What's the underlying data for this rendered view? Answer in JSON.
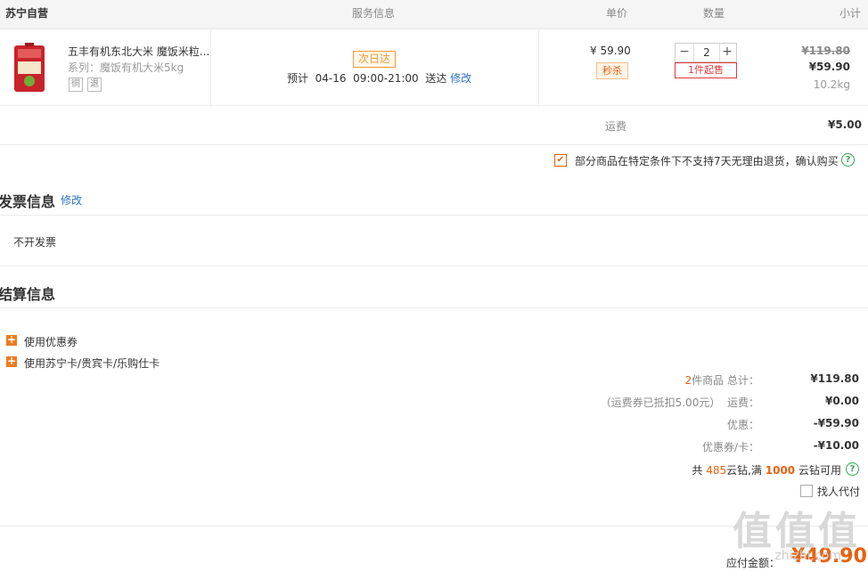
{
  "header": {
    "store": "苏宁自营",
    "service": "服务信息",
    "unit_price": "单价",
    "quantity": "数量",
    "subtotal": "小计"
  },
  "item": {
    "name": "五丰有机东北大米 魔饭米粒...",
    "series": "系列：魔饭有机大米5kg",
    "service_icon_1": "㣚",
    "service_icon_2": "退",
    "next_day": "次日达",
    "eta_prefix": "预计",
    "eta_date": "04-16",
    "eta_time": "09:00-21:00",
    "eta_suffix": "送达",
    "eta_modify": "修改",
    "unit_price": "¥ 59.90",
    "seckill": "秒杀",
    "qty_minus": "−",
    "qty": "2",
    "qty_plus": "+",
    "min_buy": "1件起售",
    "old_price": "¥119.80",
    "new_price": "¥59.90",
    "weight": "10.2kg"
  },
  "shipping": {
    "label": "运费",
    "value": "¥5.00"
  },
  "notice": {
    "text": "部分商品在特定条件下不支持7天无理由退货，确认购买",
    "checked": true
  },
  "invoice": {
    "title": "发票信息",
    "modify": "修改",
    "value": "不开发票"
  },
  "settlement": {
    "title": "结算信息",
    "coupon": "使用优惠券",
    "card": "使用苏宁卡/贵宾卡/乐购仕卡",
    "items_count": "2",
    "items_label": "件商品 总计：",
    "total": "¥119.80",
    "freight_note": "（运费券已抵扣5.00元）",
    "freight_label": "运费：",
    "freight_value": "¥0.00",
    "discount_label": "优惠：",
    "discount_value": "-¥59.90",
    "voucher_label": "优惠券/卡：",
    "voucher_value": "-¥10.00",
    "diamond_prefix": "共",
    "diamond_count": "485",
    "diamond_mid": "云钻,满",
    "diamond_threshold": "1000",
    "diamond_suffix": "云钻可用",
    "proxy_pay": "找人代付",
    "payable_label": "应付金额：",
    "payable_value": "¥49.90"
  },
  "watermark": {
    "logo": "值值值",
    "site": "zhizhi.com"
  },
  "colors": {
    "accent": "#e8610e",
    "link": "#2a73c0",
    "help": "#2fa84f"
  }
}
